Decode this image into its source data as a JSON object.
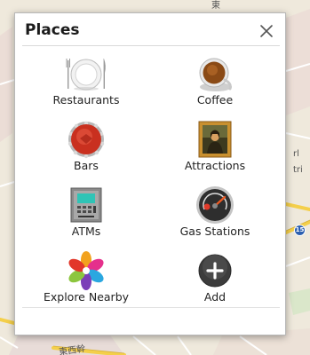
{
  "dialog": {
    "title": "Places",
    "close_icon": "close-icon"
  },
  "places": [
    {
      "label": "Restaurants",
      "icon": "plate-cutlery-icon"
    },
    {
      "label": "Coffee",
      "icon": "coffee-cup-icon"
    },
    {
      "label": "Bars",
      "icon": "bottle-cap-icon"
    },
    {
      "label": "Attractions",
      "icon": "framed-painting-icon"
    },
    {
      "label": "ATMs",
      "icon": "atm-machine-icon"
    },
    {
      "label": "Gas Stations",
      "icon": "fuel-gauge-icon"
    },
    {
      "label": "Explore Nearby",
      "icon": "explore-flower-icon"
    },
    {
      "label": "Add",
      "icon": "add-plus-icon"
    }
  ],
  "map": {
    "route_number": "15",
    "road_label_bottom": "東西幹",
    "road_label_top": "東",
    "label_right_1": "rl",
    "label_right_2": "tri"
  },
  "colors": {
    "route_shield": "#2c5fb0",
    "road_yellow": "#f4cf4a",
    "map_land": "#efe9dc"
  }
}
